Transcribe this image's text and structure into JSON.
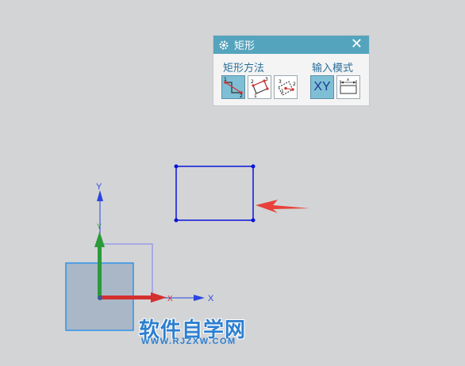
{
  "dialog": {
    "title": "矩形",
    "close_glyph": "✕",
    "method_group": {
      "label": "矩形方法",
      "tools": [
        "two-point-rect-icon",
        "three-point-rect-icon",
        "center-rect-icon"
      ],
      "selected": "two-point-rect-icon"
    },
    "input_group": {
      "label": "输入模式",
      "xy_label": "XY",
      "tools": [
        "xy-mode",
        "parameter-mode-icon"
      ],
      "selected": "xy-mode"
    }
  },
  "axes": {
    "y_label": "Y",
    "x_label": "X",
    "x_small_label": "X",
    "y_small_label": "Y"
  },
  "colors": {
    "rectangle": "#0a14d8",
    "arrow": "#e8413a",
    "csys_green": "#2a9a3a",
    "csys_red": "#d43030",
    "titlebar": "#55a4bd"
  },
  "watermark": {
    "main": "软件自学网",
    "sub": "WWW.RJZXW.COM"
  }
}
